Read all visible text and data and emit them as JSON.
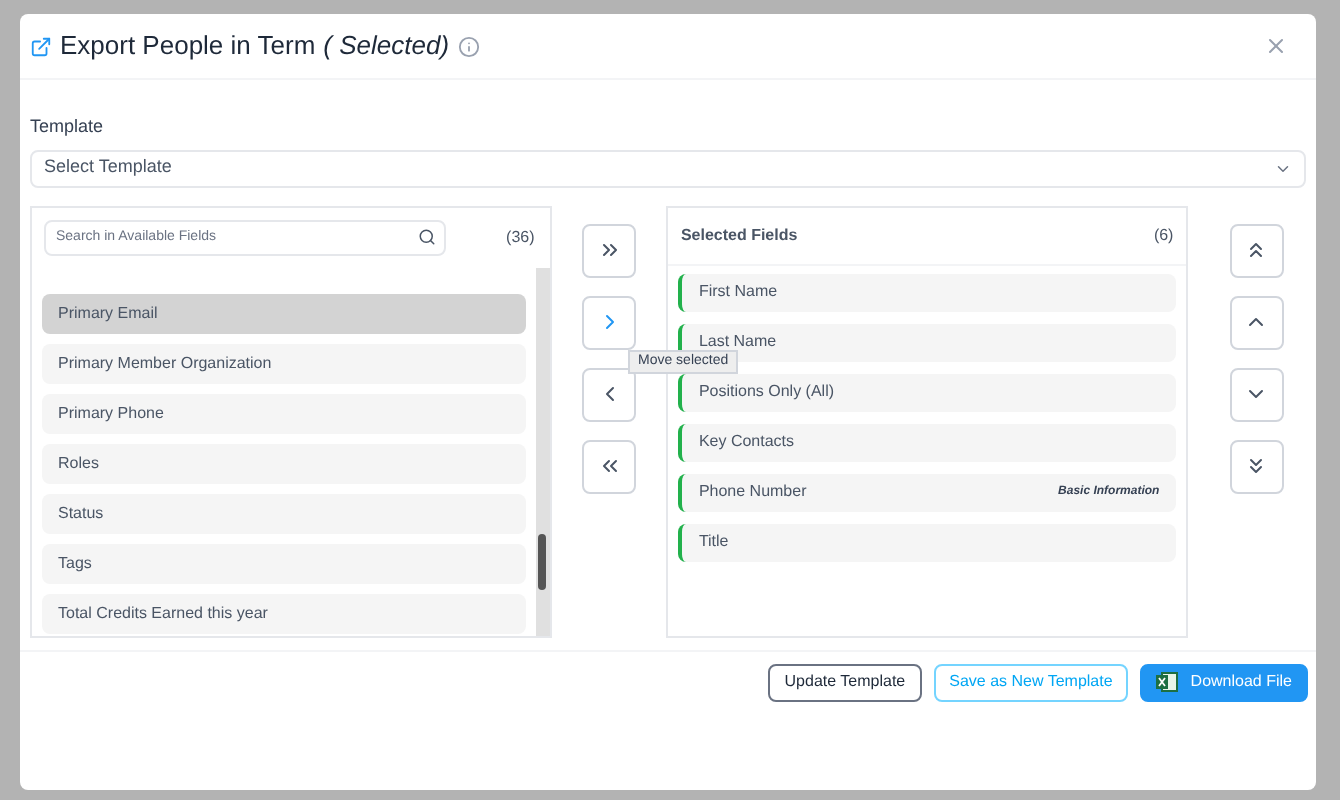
{
  "dialog": {
    "title": "Export People in Term",
    "title_suffix": "( Selected)"
  },
  "template": {
    "label": "Template",
    "placeholder": "Select Template"
  },
  "available": {
    "search_placeholder": "Search in Available Fields",
    "count": "(36)",
    "items": [
      {
        "label": "Primary Email",
        "selected": true
      },
      {
        "label": "Primary Member Organization",
        "selected": false
      },
      {
        "label": "Primary Phone",
        "selected": false
      },
      {
        "label": "Roles",
        "selected": false
      },
      {
        "label": "Status",
        "selected": false
      },
      {
        "label": "Tags",
        "selected": false
      },
      {
        "label": "Total Credits Earned this year",
        "selected": false
      }
    ]
  },
  "move_buttons": [
    {
      "kind": "all-right",
      "active": false
    },
    {
      "kind": "right",
      "active": true
    },
    {
      "kind": "left",
      "active": false
    },
    {
      "kind": "all-left",
      "active": false
    }
  ],
  "tooltip": "Move selected",
  "selected_fields": {
    "title": "Selected Fields",
    "count": "(6)",
    "items": [
      {
        "label": "First Name"
      },
      {
        "label": "Last Name"
      },
      {
        "label": "Positions Only (All)"
      },
      {
        "label": "Key Contacts"
      },
      {
        "label": "Phone Number",
        "category": "Basic Information"
      },
      {
        "label": "Title"
      }
    ]
  },
  "order_buttons": [
    {
      "kind": "top"
    },
    {
      "kind": "up"
    },
    {
      "kind": "down"
    },
    {
      "kind": "bottom"
    }
  ],
  "footer_buttons": [
    {
      "label": "Update Template",
      "kind": "outline"
    },
    {
      "label": "Save as New Template",
      "kind": "link"
    },
    {
      "label": "Download File",
      "kind": "primary"
    }
  ]
}
